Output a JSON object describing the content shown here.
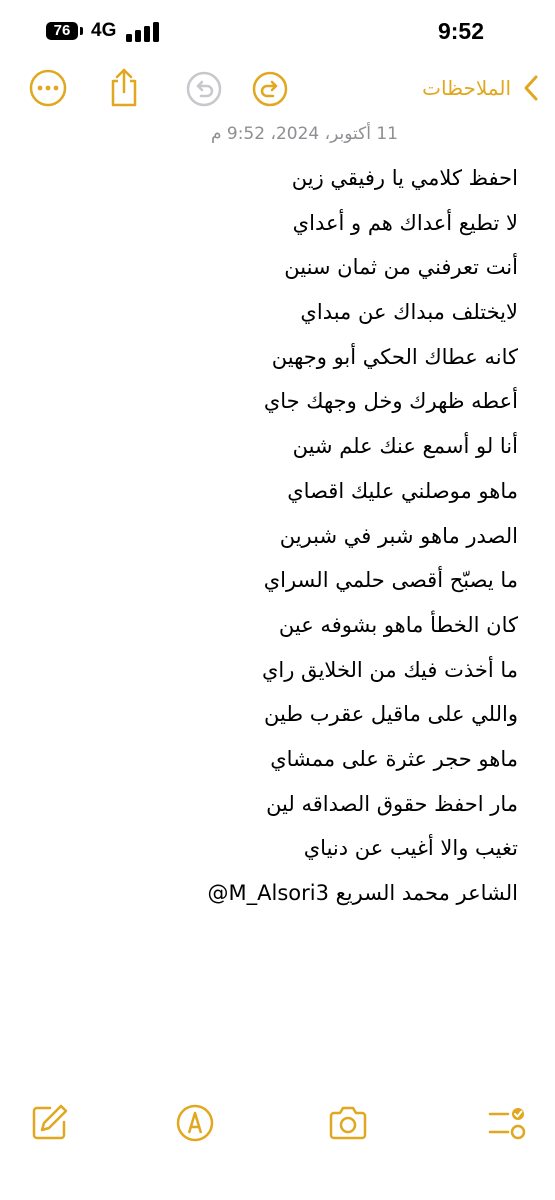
{
  "status_bar": {
    "battery_level": "76",
    "network": "4G",
    "time": "9:52"
  },
  "nav": {
    "back_label": "الملاحظات",
    "back_icon": "chevron-left-icon",
    "redo_icon": "redo-icon",
    "undo_icon": "undo-icon",
    "share_icon": "share-icon",
    "more_icon": "ellipsis-circle-icon"
  },
  "note": {
    "date": "11 أكتوبر، 2024، 9:52 م",
    "lines": [
      "احفظ كلامي يا رفيقي زين",
      "لا تطيع أعداك هم و أعداي",
      "أنت تعرفني من ثمان سنين",
      "لايختلف مبداك عن مبداي",
      "كانه عطاك الحكي أبو وجهين",
      "أعطه ظهرك وخل وجهك جاي",
      "أنا لو أسمع عنك علم شين",
      "ماهو موصلني عليك اقصاي",
      "الصدر ماهو شبر في شبرين",
      "ما يصبّح أقصى حلمي السراي",
      "كان الخطأ ماهو بشوفه عين",
      "ما أخذت فيك من الخلايق راي",
      "واللي على ماقيل عقرب طين",
      "ماهو حجر عثرة على ممشاي",
      "مار احفظ حقوق الصداقه لين",
      "تغيب والا أغيب عن دنياي",
      "الشاعر محمد السريع M_Alsori3@"
    ]
  },
  "toolbar": {
    "items": [
      "compose-icon",
      "markup-pen-icon",
      "camera-icon",
      "checklist-icon"
    ]
  },
  "colors": {
    "accent": "#E1A71E",
    "disabled": "#C7C7CC",
    "date_text": "#8E8E93",
    "text": "#000000"
  }
}
